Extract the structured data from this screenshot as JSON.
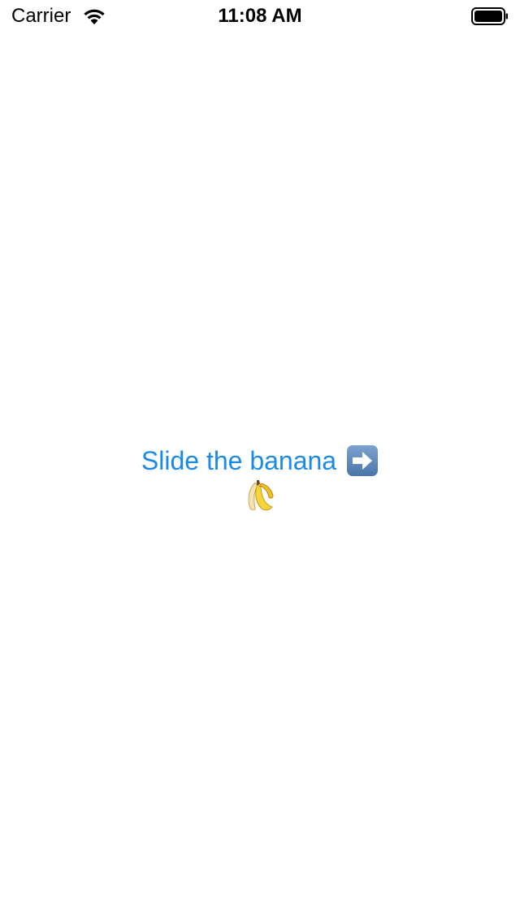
{
  "status_bar": {
    "carrier": "Carrier",
    "time": "11:08 AM",
    "wifi_icon": "wifi-icon",
    "battery_icon": "battery-icon"
  },
  "main": {
    "slide_label": "Slide the banana",
    "arrow_icon": "right-arrow-icon",
    "banana_icon": "banana-icon"
  },
  "colors": {
    "accent": "#1a8ae8",
    "background": "#ffffff",
    "arrow_tile": "#5b8bc0",
    "banana_yellow": "#f5d53a"
  }
}
